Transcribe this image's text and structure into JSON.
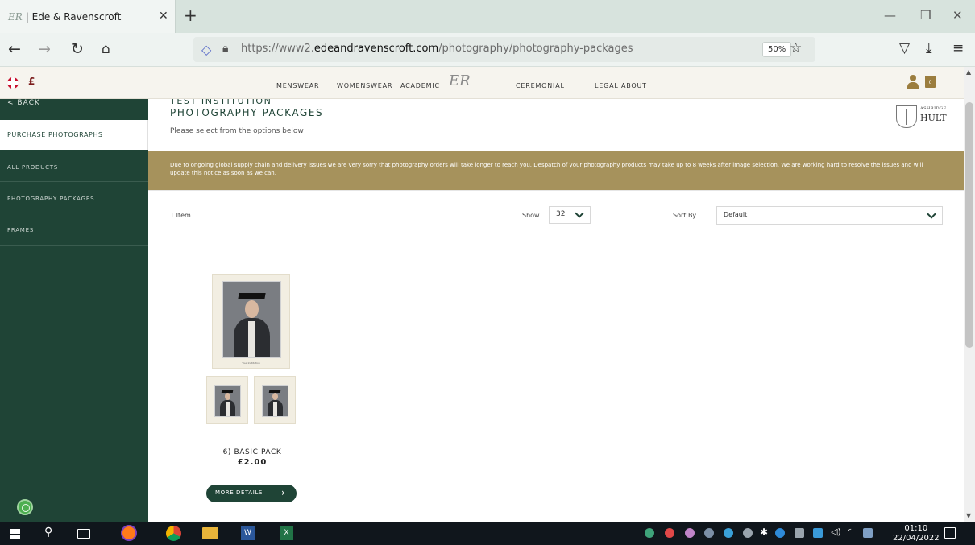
{
  "browser": {
    "tab_icon_text": "ER",
    "tab_title": "| Ede & Ravenscroft",
    "url_dim_prefix": "https://www2.",
    "url_domain": "edeandravenscroft.com",
    "url_path": "/photography/photography-packages",
    "zoom": "50%"
  },
  "site": {
    "currency": "£",
    "nav": [
      "MENSWEAR",
      "WOMENSWEAR",
      "ACADEMIC",
      "CEREMONIAL",
      "LEGAL",
      "ABOUT"
    ],
    "logo_text": "ER",
    "basket_count": "0"
  },
  "sidebar": {
    "back": "< BACK",
    "active": "PURCHASE PHOTOGRAPHS",
    "items": [
      "ALL PRODUCTS",
      "PHOTOGRAPHY PACKAGES",
      "FRAMES"
    ]
  },
  "main": {
    "institution": "TEST INSTITUTION",
    "title": "PHOTOGRAPHY PACKAGES",
    "subtitle": "Please select from the options below",
    "crest_line1": "ASHRIDGE",
    "crest_line2": "HULT",
    "notice": "Due to ongoing global supply chain and delivery issues we are very sorry that photography orders will take longer to reach you. Despatch of your photography products may take up to 8 weeks after image selection. We are working hard to resolve the issues and will update this notice as soon as we can.",
    "item_count": "1 Item",
    "show_label": "Show",
    "show_value": "32",
    "sort_label": "Sort By",
    "sort_value": "Default"
  },
  "product": {
    "caption": "Your Institution",
    "name": "6) BASIC PACK",
    "price": "£2.00",
    "button": "MORE DETAILS"
  },
  "taskbar": {
    "time": "01:10",
    "date": "22/04/2022"
  },
  "colors": {
    "brand_green": "#1f4436",
    "notice_gold": "#a6925c",
    "accent_gold": "#9b7d3e"
  }
}
